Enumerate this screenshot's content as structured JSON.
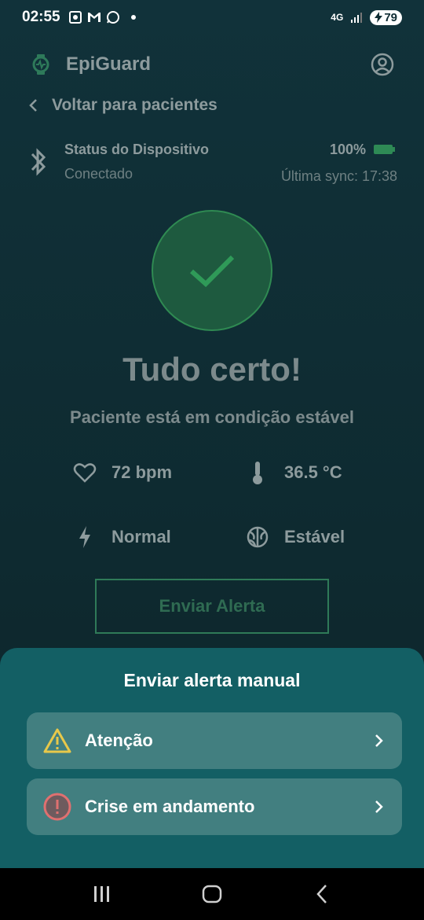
{
  "status_bar": {
    "time": "02:55",
    "network": "4G",
    "battery": "79"
  },
  "app": {
    "title": "EpiGuard"
  },
  "nav": {
    "back_label": "Voltar para pacientes"
  },
  "device": {
    "label": "Status do Dispositivo",
    "state": "Conectado",
    "battery_percent": "100%",
    "last_sync": "Última sync: 17:38"
  },
  "status": {
    "headline": "Tudo certo!",
    "subline": "Paciente está em condição estável"
  },
  "metrics": {
    "heart_rate": "72 bpm",
    "temperature": "36.5 °C",
    "activity": "Normal",
    "neuro": "Estável"
  },
  "send_alert_label": "Enviar Alerta",
  "sheet": {
    "title": "Enviar alerta manual",
    "options": [
      {
        "label": "Atenção",
        "icon": "warning-triangle-icon"
      },
      {
        "label": "Crise em andamento",
        "icon": "alert-circle-icon"
      }
    ]
  },
  "colors": {
    "background": "#0f2c33",
    "sheet": "#135f64",
    "option": "#427f80",
    "success": "#2f8a52",
    "warning": "#e8c84a",
    "danger": "#e07070"
  }
}
